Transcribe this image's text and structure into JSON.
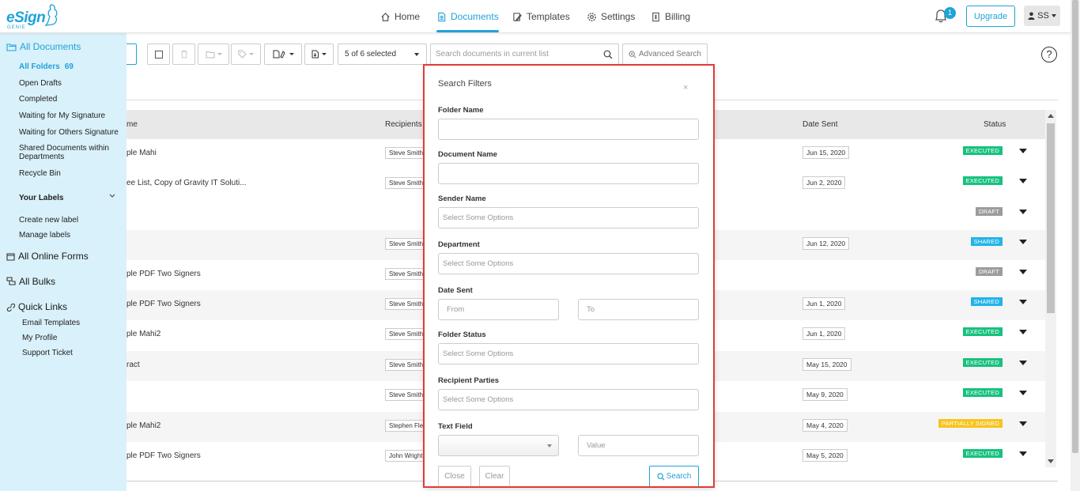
{
  "brand": {
    "name": "eSign",
    "sub": "GENIE"
  },
  "nav": [
    {
      "label": "Home",
      "icon": "home-icon"
    },
    {
      "label": "Documents",
      "icon": "document-icon"
    },
    {
      "label": "Templates",
      "icon": "template-icon"
    },
    {
      "label": "Settings",
      "icon": "gear-icon"
    },
    {
      "label": "Billing",
      "icon": "billing-icon"
    }
  ],
  "header": {
    "notifications": "1",
    "upgrade": "Upgrade",
    "user": "SS"
  },
  "sidebar": {
    "all_documents": "All Documents",
    "all_folders": "All Folders",
    "all_folders_count": "69",
    "items": [
      "Open Drafts",
      "Completed",
      "Waiting for My Signature",
      "Waiting for Others Signature",
      "Shared Documents within Departments",
      "Recycle Bin"
    ],
    "your_labels": "Your Labels",
    "label_items": [
      "Create new label",
      "Manage labels"
    ],
    "all_online_forms": "All Online Forms",
    "all_bulks": "All Bulks",
    "quick_links": "Quick Links",
    "quick_items": [
      "Email Templates",
      "My Profile",
      "Support Ticket"
    ]
  },
  "toolbar": {
    "selected": "5 of 6 selected",
    "search_placeholder": "Search documents in current list",
    "advanced_search": "Advanced Search",
    "help": "?"
  },
  "table": {
    "headers": {
      "name": "me",
      "recipients": "Recipients Na",
      "date_sent": "Date Sent",
      "status": "Status"
    },
    "rows": [
      {
        "name": "ple Mahi",
        "recipient": "Steve Smith",
        "date": "Jun 15, 2020",
        "status": "EXECUTED",
        "kind": "exec"
      },
      {
        "name": "ee List, Copy of Gravity IT Soluti...",
        "recipient": "Steve Smith",
        "date": "Jun 2, 2020",
        "status": "EXECUTED",
        "kind": "exec"
      },
      {
        "name": "",
        "recipient": "",
        "date": "",
        "status": "DRAFT",
        "kind": "draft"
      },
      {
        "name": "",
        "recipient": "Steve Smith",
        "date": "Jun 12, 2020",
        "status": "SHARED",
        "kind": "shared"
      },
      {
        "name": "ple PDF Two Signers",
        "recipient": "Steve Smith",
        "date": "",
        "status": "DRAFT",
        "kind": "draft"
      },
      {
        "name": "ple PDF Two Signers",
        "recipient": "Steve Smith",
        "date": "Jun 1, 2020",
        "status": "SHARED",
        "kind": "shared"
      },
      {
        "name": "ple Mahi2",
        "recipient": "Steve Smith",
        "date": "Jun 1, 2020",
        "status": "EXECUTED",
        "kind": "exec"
      },
      {
        "name": "ract",
        "recipient": "Steve Smith",
        "date": "May 15, 2020",
        "status": "EXECUTED",
        "kind": "exec"
      },
      {
        "name": "",
        "recipient": "Steve Smith",
        "date": "May 9, 2020",
        "status": "EXECUTED",
        "kind": "exec"
      },
      {
        "name": "ple Mahi2",
        "recipient": "Stephen Fleming",
        "date": "May 4, 2020",
        "status": "PARTIALLY SIGNED",
        "kind": "partial"
      },
      {
        "name": "ple PDF Two Signers",
        "recipient": "John Wright",
        "date": "May 5, 2020",
        "status": "EXECUTED",
        "kind": "exec"
      }
    ]
  },
  "modal": {
    "title": "Search Filters",
    "close_x": "×",
    "folder_name": "Folder Name",
    "document_name": "Document Name",
    "sender_name": "Sender Name",
    "sender_placeholder": "Select Some Options",
    "department": "Department",
    "department_placeholder": "Select Some Options",
    "date_sent": "Date Sent",
    "from": "From",
    "to": "To",
    "folder_status": "Folder Status",
    "folder_status_placeholder": "Select Some Options",
    "recipient_parties": "Recipient Parties",
    "recipient_placeholder": "Select Some Options",
    "text_field": "Text Field",
    "value": "Value",
    "close_btn": "Close",
    "clear_btn": "Clear",
    "search_btn": "Search"
  },
  "colors": {
    "accent": "#1fa3d8",
    "executed": "#17c17e",
    "draft": "#9c9c9c",
    "shared": "#22b4e8",
    "partial": "#f7c41f",
    "highlight": "#e23a3a"
  }
}
